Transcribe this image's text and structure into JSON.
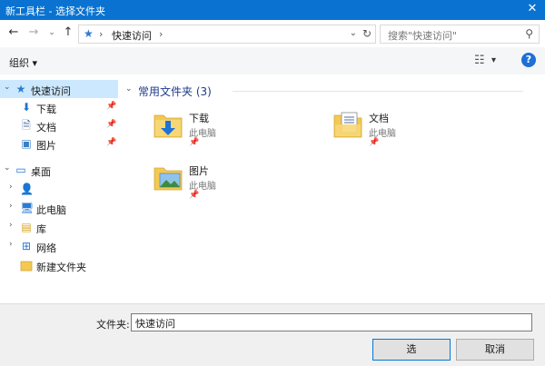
{
  "window": {
    "title": "新工具栏 - 选择文件夹",
    "close_glyph": "✕"
  },
  "address": {
    "crumb": "快速访问",
    "separator": "›",
    "dropdown": "⌄",
    "refresh": "↻"
  },
  "search": {
    "placeholder": "搜索\"快速访问\"",
    "icon": "search-icon"
  },
  "toolbar": {
    "organize": "组织 ▾",
    "help": "?"
  },
  "nav": {
    "items": [
      {
        "label": "快速访问",
        "icon": "star-pin-icon",
        "selected": true
      },
      {
        "label": "下载",
        "icon": "download-icon",
        "pinned": true
      },
      {
        "label": "文档",
        "icon": "document-icon",
        "pinned": true
      },
      {
        "label": "图片",
        "icon": "picture-icon",
        "pinned": true
      },
      {
        "label": "桌面",
        "icon": "desktop-icon"
      },
      {
        "label": "",
        "icon": "user-icon"
      },
      {
        "label": "此电脑",
        "icon": "computer-icon"
      },
      {
        "label": "库",
        "icon": "library-icon"
      },
      {
        "label": "网络",
        "icon": "network-icon"
      },
      {
        "label": "新建文件夹",
        "icon": "folder-icon"
      }
    ]
  },
  "content": {
    "group_title": "常用文件夹 (3)",
    "tiles": [
      {
        "name": "下载",
        "location": "此电脑"
      },
      {
        "name": "文档",
        "location": "此电脑"
      },
      {
        "name": "图片",
        "location": "此电脑"
      }
    ]
  },
  "footer": {
    "folder_label": "文件夹:",
    "folder_value": "快速访问",
    "select_button": "选",
    "cancel_button": "取消"
  },
  "colors": {
    "titlebar": "#0a73d1",
    "selected": "#cce8ff",
    "folder": "#f3c953"
  }
}
